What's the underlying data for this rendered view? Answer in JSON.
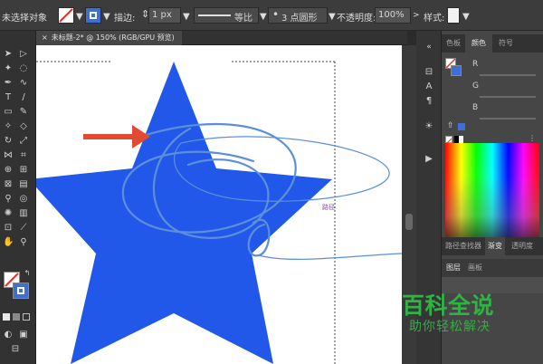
{
  "control_bar": {
    "selection_status": "未选择对象",
    "stroke_label": "描边:",
    "stroke_weight": "1 px",
    "variable_width_profile": "等比",
    "brush_definition": "3 点圆形",
    "opacity_label": "不透明度:",
    "opacity_value": "100%",
    "style_label": "样式:"
  },
  "document_tab": {
    "title": "未标题-2* @ 150% (RGB/GPU 预览)"
  },
  "canvas": {
    "star_color": "#2158ea",
    "path_color": "#5b8fdc",
    "arrow_color": "#e24a33",
    "path_label": "路径"
  },
  "right_panel": {
    "top_tabs": [
      "色板",
      "颜色",
      "符号"
    ],
    "active_top_tab": "颜色",
    "channels": [
      "R",
      "G",
      "B"
    ],
    "bottom_tabs": [
      "路径查找器",
      "渐变",
      "透明度"
    ],
    "active_bottom_tab": "渐变",
    "layer_tabs": [
      "图层",
      "画板"
    ]
  },
  "icons": [
    "selection-tool-icon",
    "direct-selection-tool-icon",
    "pen-tool-icon",
    "type-tool-icon",
    "brush-tool-icon",
    "shape-builder-icon",
    "chart-tool-icon",
    "hand-tool-icon",
    "zoom-tool-icon"
  ],
  "watermark": {
    "title": "百科全说",
    "subtitle": "助你轻松解决"
  }
}
